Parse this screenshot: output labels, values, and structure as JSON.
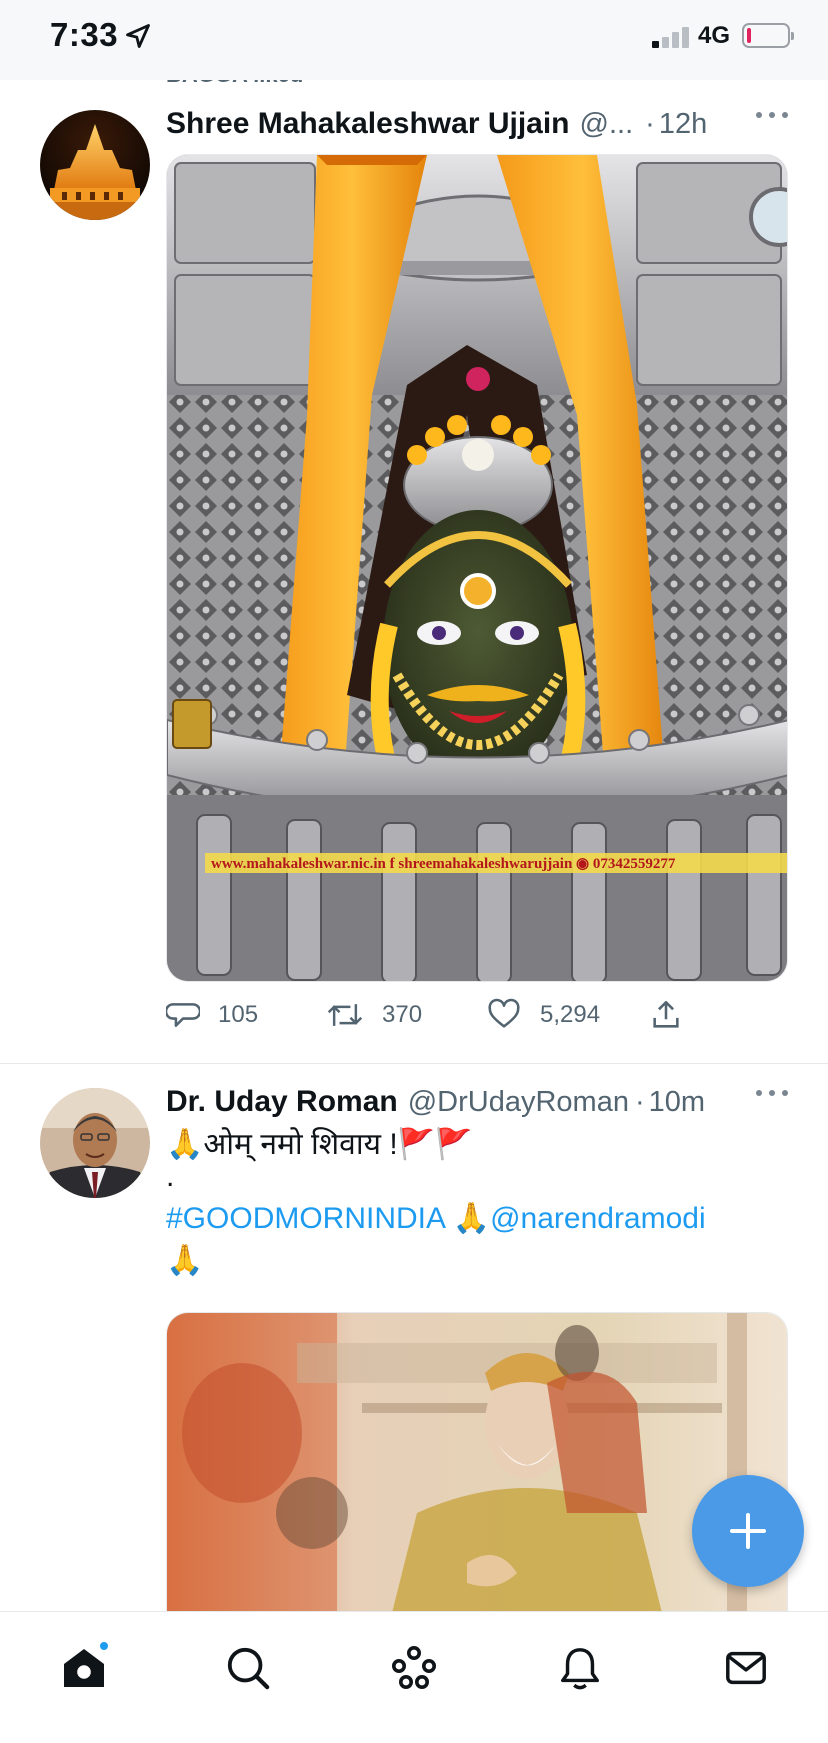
{
  "status_bar": {
    "time": "7:33",
    "network": "4G"
  },
  "liked_bar": {
    "text": "BAGGA liked"
  },
  "tweets": [
    {
      "display_name": "Shree Mahakaleshwar Ujjain",
      "handle": "@...",
      "time": "12h",
      "media": {
        "watermark": "www.mahakaleshwar.nic.in  f shreemahakaleshwarujjain  ◉ 07342559277"
      },
      "actions": {
        "replies": "105",
        "retweets": "370",
        "likes": "5,294"
      }
    },
    {
      "display_name": "Dr. Uday Roman",
      "handle": "@DrUdayRoman",
      "time": "10m",
      "text_line1": "🙏ओम् नमो शिवाय !🚩🚩",
      "text_line2": ".",
      "hashtag": "#GOODMORNINDIA",
      "mention": "🙏@narendramodi",
      "text_line4": "🙏"
    }
  ],
  "tab_bar": {
    "items": [
      "home-icon",
      "search-icon",
      "spaces-icon",
      "notifications-icon",
      "messages-icon"
    ]
  },
  "colors": {
    "accent": "#1d9bf0",
    "fab": "#4a9ae8",
    "secondary_text": "#536471"
  }
}
